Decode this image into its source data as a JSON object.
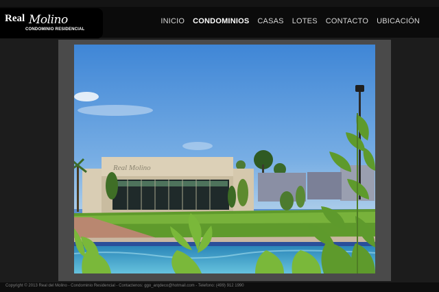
{
  "brand": {
    "name_part1": "Real",
    "name_part2": "Molino",
    "tagline": "CONDOMINIO RESIDENCIAL"
  },
  "nav": {
    "items": [
      {
        "label": "INICIO",
        "active": false
      },
      {
        "label": "CONDOMINIOS",
        "active": true
      },
      {
        "label": "CASAS",
        "active": false
      },
      {
        "label": "LOTES",
        "active": false
      },
      {
        "label": "CONTACTO",
        "active": false
      },
      {
        "label": "UBICACIÓN",
        "active": false
      }
    ]
  },
  "gallery": {
    "building_sign": "Real Molino"
  },
  "footer": {
    "text": "Copyright © 2013 Real del Molino - Condominio Residencial - Contactenos: ggo_arqdeco@hotmail.com - Telefono: (499) 912 1990"
  },
  "colors": {
    "page_bg": "#1c1c1c",
    "nav_bg": "#0b0b0b",
    "frame": "#4a4a4a",
    "active_nav": "#ffffff"
  }
}
